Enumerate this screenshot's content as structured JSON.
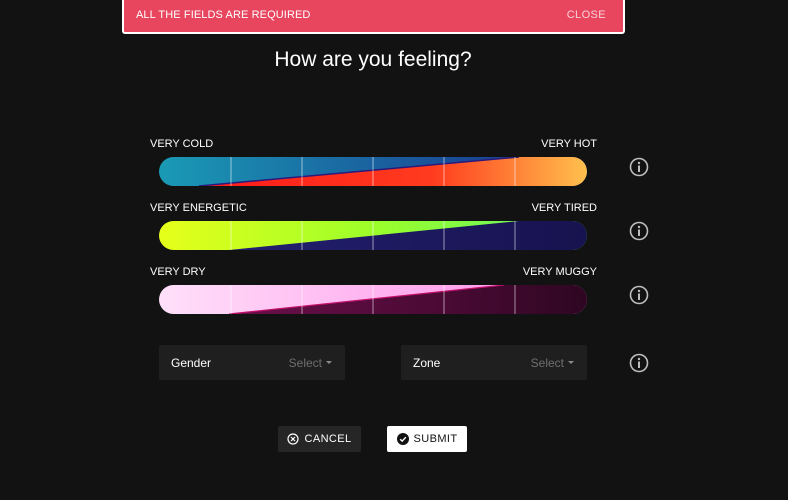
{
  "alert": {
    "message": "ALL THE FIELDS ARE REQUIRED",
    "close_label": "CLOSE",
    "color": "#e8465f"
  },
  "title": "How are you feeling?",
  "sliders": [
    {
      "left_label": "VERY COLD",
      "right_label": "VERY HOT",
      "icon": "info-icon"
    },
    {
      "left_label": "VERY ENERGETIC",
      "right_label": "VERY TIRED",
      "icon": "info-icon"
    },
    {
      "left_label": "VERY DRY",
      "right_label": "VERY MUGGY",
      "icon": "info-icon"
    }
  ],
  "selects": [
    {
      "label": "Gender",
      "value": "Select"
    },
    {
      "label": "Zone",
      "value": "Select"
    }
  ],
  "buttons": {
    "cancel": "CANCEL",
    "submit": "SUBMIT"
  }
}
